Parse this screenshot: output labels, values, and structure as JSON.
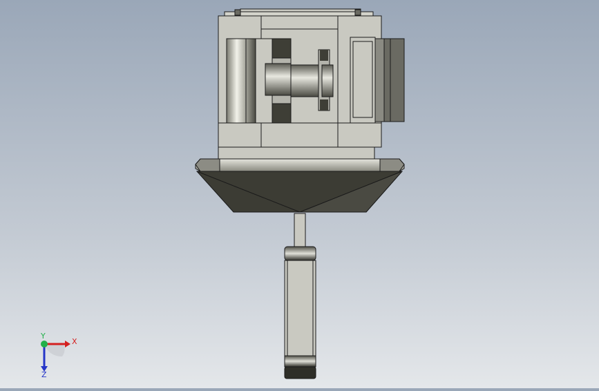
{
  "viewport": {
    "background_top": "#9aa7b8",
    "background_bottom": "#e4e7ea",
    "model": {
      "body_color": "#c9c9c1",
      "dark_color": "#3c3c34",
      "edge_color": "#1a1a1a"
    }
  },
  "triad": {
    "x_label": "X",
    "y_label": "Y",
    "z_label": "Z",
    "x_color": "#d42020",
    "y_color": "#22b04a",
    "z_color": "#2535c8"
  }
}
